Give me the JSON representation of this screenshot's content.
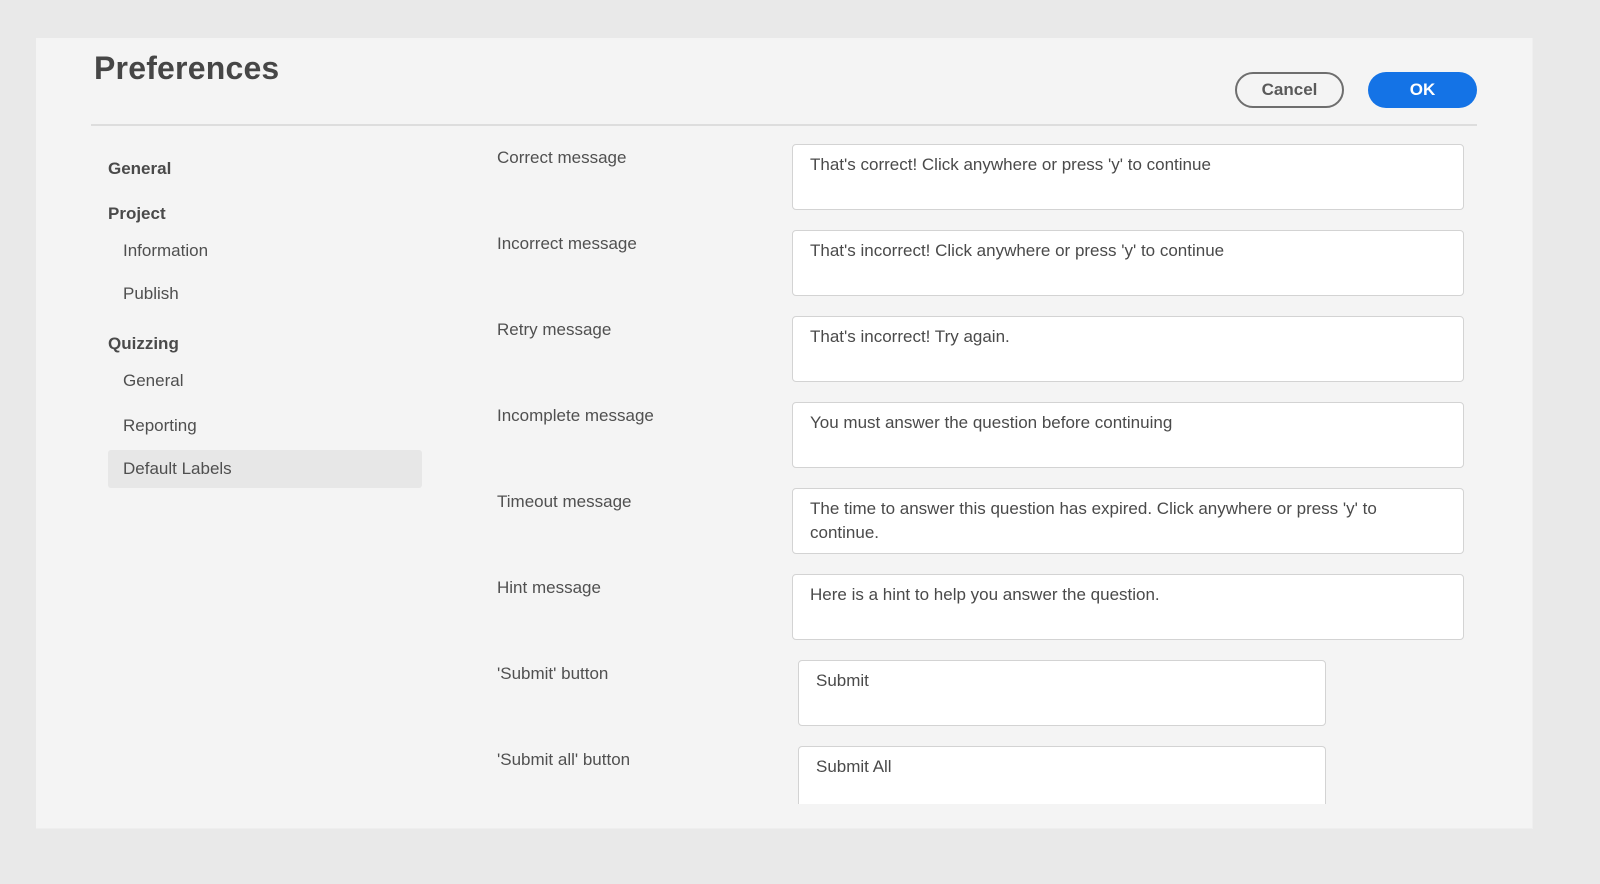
{
  "dialog": {
    "title": "Preferences",
    "buttons": {
      "cancel": "Cancel",
      "ok": "OK"
    },
    "accent_color": "#1473e6"
  },
  "sidebar": {
    "general": "General",
    "project": {
      "heading": "Project",
      "items": [
        "Information",
        "Publish"
      ]
    },
    "quizzing": {
      "heading": "Quizzing",
      "items": [
        "General",
        "Reporting",
        "Default Labels"
      ]
    },
    "selected": "Default Labels"
  },
  "fields": [
    {
      "label": "Correct message",
      "value": "That's correct! Click anywhere or press 'y' to continue"
    },
    {
      "label": "Incorrect message",
      "value": "That's incorrect! Click anywhere or press 'y' to continue"
    },
    {
      "label": "Retry message",
      "value": "That's incorrect! Try again."
    },
    {
      "label": "Incomplete message",
      "value": "You must answer the question before continuing"
    },
    {
      "label": "Timeout message",
      "value": "The time to answer this question has expired. Click anywhere or press 'y' to continue."
    },
    {
      "label": "Hint message",
      "value": "Here is a hint to help you answer the question."
    },
    {
      "label": "'Submit' button",
      "value": "Submit"
    },
    {
      "label": "'Submit all' button",
      "value": "Submit All"
    }
  ]
}
